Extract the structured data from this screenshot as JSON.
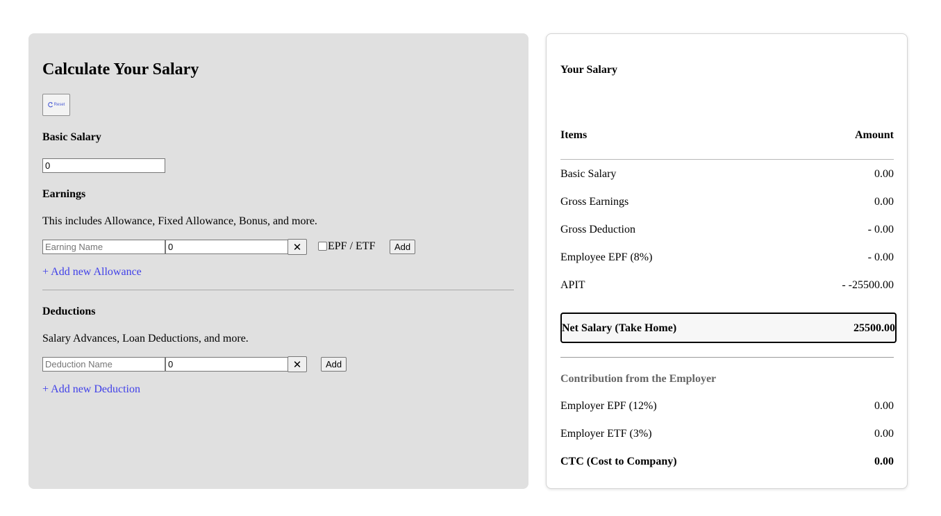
{
  "calculator": {
    "title": "Calculate Your Salary",
    "reset_label": "Reset",
    "basic_salary": {
      "label": "Basic Salary",
      "value": "0"
    },
    "earnings": {
      "label": "Earnings",
      "description": "This includes Allowance, Fixed Allowance, Bonus, and more.",
      "name_placeholder": "Earning Name",
      "amount_value": "0",
      "epf_etf_label": "EPF / ETF",
      "epf_etf_checked": false,
      "add_label": "Add",
      "add_new_link": "+ Add new Allowance"
    },
    "deductions": {
      "label": "Deductions",
      "description": "Salary Advances, Loan Deductions, and more.",
      "name_placeholder": "Deduction Name",
      "amount_value": "0",
      "add_label": "Add",
      "add_new_link": "+ Add new Deduction"
    },
    "remove_symbol": "✕"
  },
  "summary": {
    "title": "Your Salary",
    "col_items": "Items",
    "col_amount": "Amount",
    "rows": [
      {
        "label": "Basic Salary",
        "value": "0.00"
      },
      {
        "label": "Gross Earnings",
        "value": "0.00"
      },
      {
        "label": "Gross Deduction",
        "value": "- 0.00"
      },
      {
        "label": "Employee EPF (8%)",
        "value": "- 0.00"
      },
      {
        "label": "APIT",
        "value": "- -25500.00"
      }
    ],
    "net": {
      "label": "Net Salary (Take Home)",
      "value": "25500.00"
    },
    "employer_heading": "Contribution from the Employer",
    "employer_rows": [
      {
        "label": "Employer EPF (12%)",
        "value": "0.00"
      },
      {
        "label": "Employer ETF (3%)",
        "value": "0.00"
      }
    ],
    "ctc": {
      "label": "CTC (Cost to Company)",
      "value": "0.00"
    }
  },
  "colors": {
    "panel_bg": "#e0e0e0",
    "link": "#3f3fe8",
    "muted_heading": "#666666"
  },
  "icons": {
    "reset": "refresh-icon",
    "remove": "close-icon"
  }
}
